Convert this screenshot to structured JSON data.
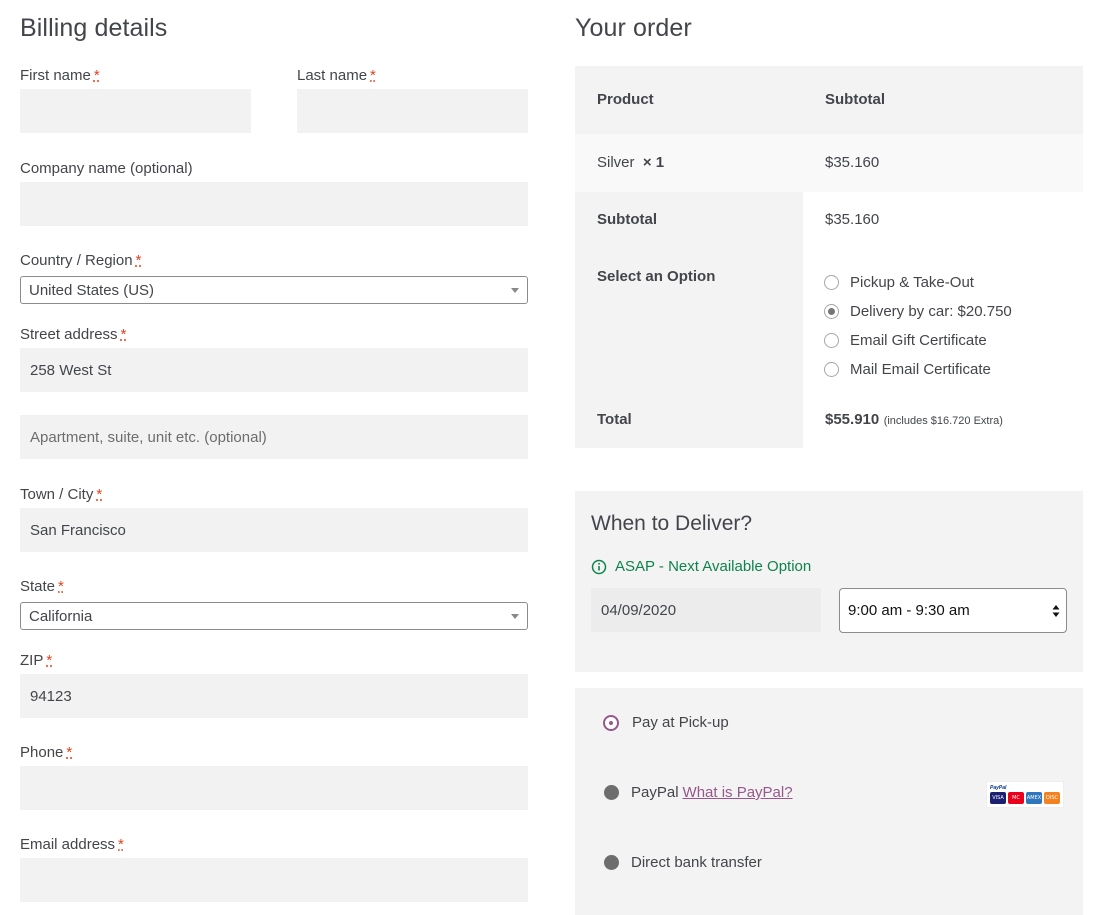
{
  "billing": {
    "title": "Billing details",
    "first_name_label": "First name",
    "last_name_label": "Last name",
    "company_label": "Company name (optional)",
    "country_label": "Country / Region",
    "country_value": "United States (US)",
    "street_label": "Street address",
    "street_value": "258 West St",
    "apartment_placeholder": "Apartment, suite, unit etc. (optional)",
    "city_label": "Town / City",
    "city_value": "San Francisco",
    "state_label": "State",
    "state_value": "California",
    "zip_label": "ZIP",
    "zip_value": "94123",
    "phone_label": "Phone",
    "email_label": "Email address",
    "required_mark": "*"
  },
  "order": {
    "title": "Your order",
    "col_product": "Product",
    "col_subtotal": "Subtotal",
    "item_name": "Silver",
    "item_qty": "× 1",
    "item_price": "$35.160",
    "subtotal_label": "Subtotal",
    "subtotal_value": "$35.160",
    "option_label": "Select an Option",
    "options": [
      {
        "label": "Pickup & Take-Out",
        "checked": false
      },
      {
        "label": "Delivery by car: $20.750",
        "checked": true
      },
      {
        "label": "Email Gift Certificate",
        "checked": false
      },
      {
        "label": "Mail Email Certificate",
        "checked": false
      }
    ],
    "total_label": "Total",
    "total_value": "$55.910",
    "total_note": "(includes $16.720 Extra)"
  },
  "delivery": {
    "title": "When to Deliver?",
    "asap_text": "ASAP - Next Available Option",
    "date_value": "04/09/2020",
    "time_value": "9:00 am - 9:30 am"
  },
  "payment": {
    "methods": [
      {
        "label": "Pay at Pick-up",
        "selected": true
      },
      {
        "label": "PayPal",
        "link": "What is PayPal?",
        "selected": false
      },
      {
        "label": "Direct bank transfer",
        "selected": false
      }
    ],
    "paypal_logo_text": "PayPal",
    "card_names": [
      "VISA",
      "MC",
      "AMEX",
      "DISC"
    ]
  },
  "colors": {
    "accent": "#96588a",
    "success": "#0f834d",
    "required": "#e2401c",
    "field_bg": "#f2f2f2"
  }
}
